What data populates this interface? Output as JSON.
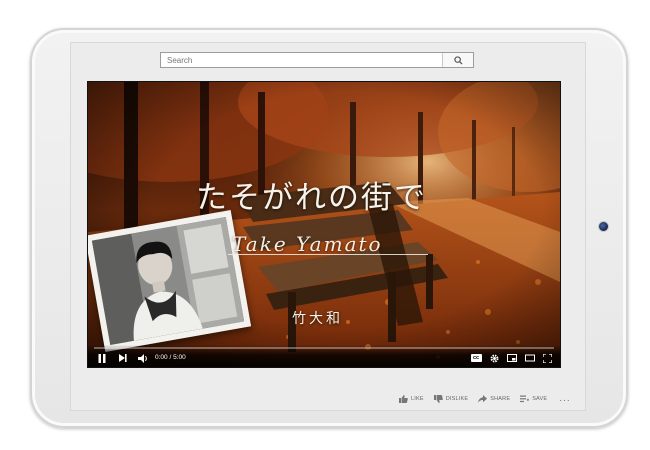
{
  "search": {
    "placeholder": "Search"
  },
  "video": {
    "title_jp": "たそがれの街で",
    "artist_en": "Take Yamato",
    "artist_jp": "竹大和",
    "time_display": "0:00 / 5:00",
    "progress": 0,
    "cc_label": "cc"
  },
  "actions": {
    "like": "LIKE",
    "dislike": "DISLIKE",
    "share": "SHARE",
    "save": "SAVE",
    "more": "..."
  },
  "colors": {
    "accent_orange": "#c8561a",
    "screen_bg": "#ececec",
    "device_frame": "#e8e8e8"
  },
  "icons": [
    "search-icon",
    "play-pause-icon",
    "next-icon",
    "volume-icon",
    "cc-icon",
    "gear-icon",
    "miniplayer-icon",
    "theater-icon",
    "fullscreen-icon",
    "thumbs-up-icon",
    "thumbs-down-icon",
    "share-icon",
    "save-icon",
    "more-icon"
  ]
}
